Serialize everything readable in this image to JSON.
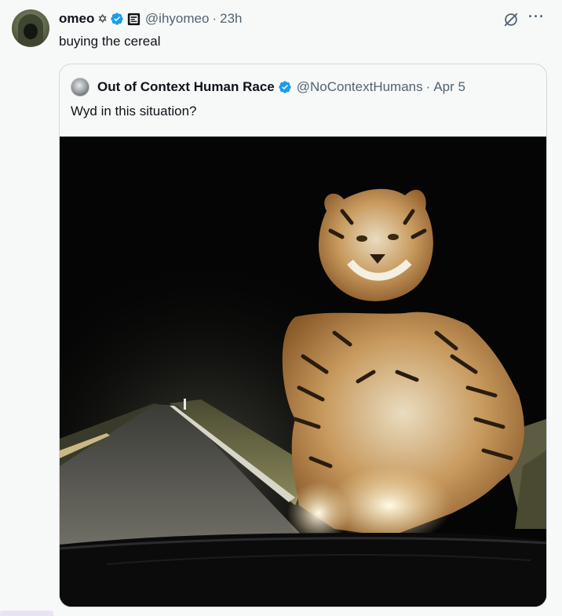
{
  "post": {
    "author_name": "omeo",
    "star_glyph": "✡",
    "handle": "@ihyomeo",
    "separator": "·",
    "time": "23h",
    "text": "buying the cereal",
    "more_glyph": "···"
  },
  "quote": {
    "author_name": "Out of Context Human Race",
    "handle": "@NoContextHumans",
    "separator": "·",
    "date": "Apr 5",
    "text": "Wyd in this situation?"
  },
  "colors": {
    "verified": "#1d9bf0",
    "secondary_text": "#536471",
    "border": "#cfd9de"
  },
  "icons": {
    "verified": "verified-badge-icon",
    "affiliate": "affiliate-badge-icon",
    "grok": "grok-icon",
    "more": "more-options-icon"
  }
}
